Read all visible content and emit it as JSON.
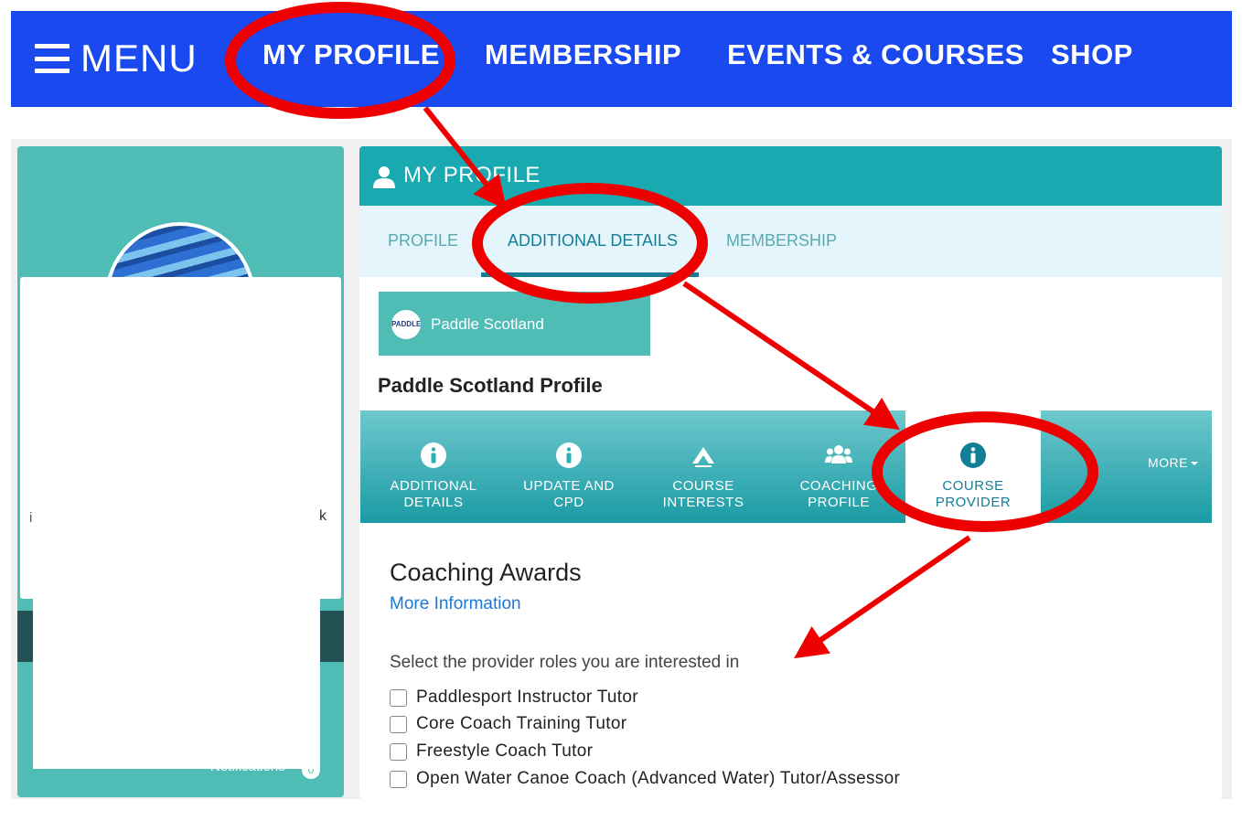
{
  "topnav": {
    "menu_label": "MENU",
    "items": [
      {
        "label": "MY PROFILE"
      },
      {
        "label": "MEMBERSHIP"
      },
      {
        "label": "EVENTS & COURSES"
      },
      {
        "label": "SHOP"
      }
    ]
  },
  "left_panel": {
    "fragment_left": "i",
    "fragment_right": "k",
    "notifications_label": "Notifications",
    "notifications_count": "0"
  },
  "main": {
    "title": "MY PROFILE",
    "tabs": [
      {
        "label": "PROFILE"
      },
      {
        "label": "ADDITIONAL DETAILS"
      },
      {
        "label": "MEMBERSHIP"
      }
    ],
    "org": {
      "logo_text": "PADDLE",
      "name": "Paddle Scotland"
    },
    "profile_heading": "Paddle Scotland Profile",
    "subnav": [
      {
        "line1": "ADDITIONAL",
        "line2": "DETAILS",
        "icon": "info-icon"
      },
      {
        "line1": "UPDATE AND",
        "line2": "CPD",
        "icon": "info-icon"
      },
      {
        "line1": "COURSE",
        "line2": "INTERESTS",
        "icon": "paddle-logo-icon"
      },
      {
        "line1": "COACHING",
        "line2": "PROFILE",
        "icon": "users-icon"
      },
      {
        "line1": "COURSE",
        "line2": "PROVIDER",
        "icon": "info-icon"
      }
    ],
    "more_label": "MORE",
    "section": {
      "title": "Coaching Awards",
      "more_info": "More Information",
      "select_label": "Select the provider roles you are interested in",
      "roles": [
        "Paddlesport Instructor Tutor",
        "Core Coach Training Tutor",
        "Freestyle Coach Tutor",
        "Open Water Canoe Coach (Advanced Water) Tutor/Assessor"
      ]
    }
  },
  "colors": {
    "nav_blue": "#1a49f0",
    "teal": "#19a9b0",
    "annotation_red": "#ee0000"
  }
}
